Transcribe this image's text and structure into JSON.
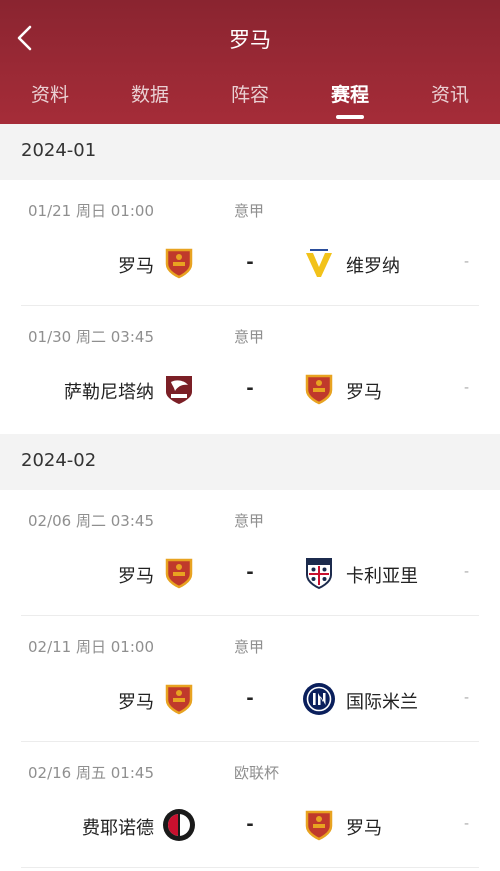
{
  "header": {
    "title": "罗马",
    "back_icon": "back-arrow-icon",
    "tabs": [
      {
        "label": "资料",
        "active": false
      },
      {
        "label": "数据",
        "active": false
      },
      {
        "label": "阵容",
        "active": false
      },
      {
        "label": "赛程",
        "active": true
      },
      {
        "label": "资讯",
        "active": false
      }
    ]
  },
  "colors": {
    "header": "#9a2935",
    "month_bg": "#f3f3f3",
    "muted_text": "#8f8f8f"
  },
  "schedule": [
    {
      "month": "2024-01",
      "matches": [
        {
          "datetime": "01/21  周日 01:00",
          "competition": "意甲",
          "home": "罗马",
          "home_logo": "roma-crest-icon",
          "vs": "-",
          "away": "维罗纳",
          "away_logo": "verona-crest-icon",
          "score": "-"
        },
        {
          "datetime": "01/30  周二 03:45",
          "competition": "意甲",
          "home": "萨勒尼塔纳",
          "home_logo": "salernitana-crest-icon",
          "vs": "-",
          "away": "罗马",
          "away_logo": "roma-crest-icon",
          "score": "-"
        }
      ]
    },
    {
      "month": "2024-02",
      "matches": [
        {
          "datetime": "02/06  周二 03:45",
          "competition": "意甲",
          "home": "罗马",
          "home_logo": "roma-crest-icon",
          "vs": "-",
          "away": "卡利亚里",
          "away_logo": "cagliari-crest-icon",
          "score": "-"
        },
        {
          "datetime": "02/11  周日 01:00",
          "competition": "意甲",
          "home": "罗马",
          "home_logo": "roma-crest-icon",
          "vs": "-",
          "away": "国际米兰",
          "away_logo": "inter-crest-icon",
          "score": "-"
        },
        {
          "datetime": "02/16  周五 01:45",
          "competition": "欧联杯",
          "home": "费耶诺德",
          "home_logo": "feyenoord-crest-icon",
          "vs": "-",
          "away": "罗马",
          "away_logo": "roma-crest-icon",
          "score": "-"
        }
      ]
    }
  ]
}
